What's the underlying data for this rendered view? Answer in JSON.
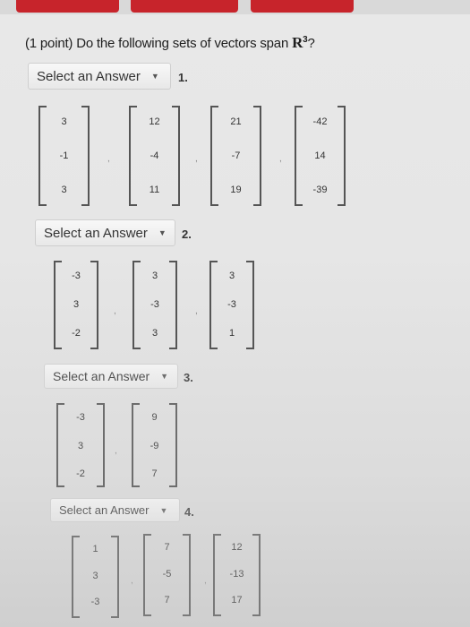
{
  "question": {
    "prefix": "(1 point) Do the following sets of vectors span",
    "space_symbol": "R",
    "space_exponent": "3",
    "suffix": "?"
  },
  "parts": [
    {
      "select_label": "Select an Answer",
      "number": "1.",
      "vectors": [
        [
          "3",
          "-1",
          "3"
        ],
        [
          "12",
          "-4",
          "11"
        ],
        [
          "21",
          "-7",
          "19"
        ],
        [
          "-42",
          "14",
          "-39"
        ]
      ],
      "separator": ","
    },
    {
      "select_label": "Select an Answer",
      "number": "2.",
      "vectors": [
        [
          "-3",
          "3",
          "-2"
        ],
        [
          "3",
          "-3",
          "3"
        ],
        [
          "3",
          "-3",
          "1"
        ]
      ],
      "separator": ","
    },
    {
      "select_label": "Select an Answer",
      "number": "3.",
      "vectors": [
        [
          "-3",
          "3",
          "-2"
        ],
        [
          "9",
          "-9",
          "7"
        ]
      ],
      "separator": ","
    },
    {
      "select_label": "Select an Answer",
      "number": "4.",
      "vectors": [
        [
          "1",
          "3",
          "-3"
        ],
        [
          "7",
          "-5",
          "7"
        ],
        [
          "12",
          "-13",
          "17"
        ]
      ],
      "separator": ","
    }
  ],
  "icons": {
    "dropdown_arrow": "▼"
  },
  "colors": {
    "top_button": "#c7242b"
  }
}
